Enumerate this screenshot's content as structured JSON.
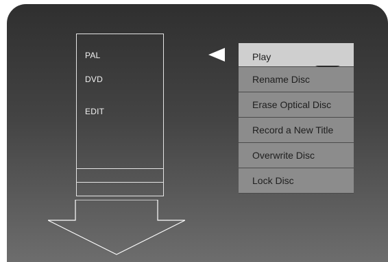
{
  "disc_info": {
    "format": "PAL",
    "type": "DVD",
    "mode": "EDIT"
  },
  "menu": {
    "items": [
      {
        "label": "Play",
        "selected": true
      },
      {
        "label": "Rename Disc",
        "selected": false
      },
      {
        "label": "Erase Optical Disc",
        "selected": false
      },
      {
        "label": "Record a New Title",
        "selected": false
      },
      {
        "label": "Overwrite Disc",
        "selected": false
      },
      {
        "label": "Lock Disc",
        "selected": false
      }
    ]
  },
  "colors": {
    "selected_item_bg": "#cfcfcf",
    "item_bg": "#8c8c8c",
    "outline": "#ffffff"
  },
  "icons": {
    "pointer": "triangle-left-icon",
    "down_arrow": "down-arrow-icon"
  }
}
